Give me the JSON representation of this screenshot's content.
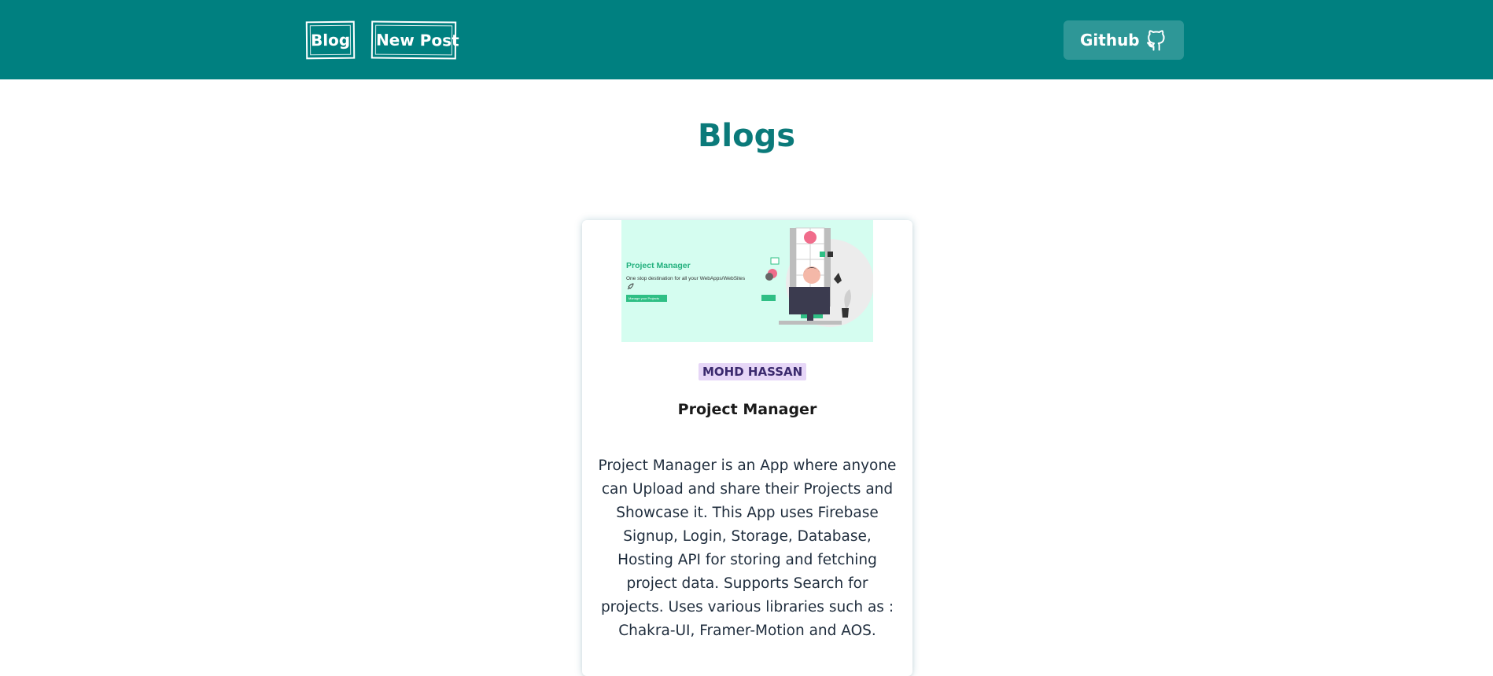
{
  "navbar": {
    "links": [
      {
        "label": "Blog"
      },
      {
        "label": "New Post"
      }
    ],
    "github": {
      "label": "Github",
      "icon": "github-icon"
    }
  },
  "page": {
    "title": "Blogs"
  },
  "post": {
    "thumbnail": {
      "title": "Project Manager",
      "subtitle": "One stop destination for all your WebApps/WebSites",
      "button": "Manage your Projects"
    },
    "author": "MOHD HASSAN",
    "title": "Project Manager",
    "description": "Project Manager is an App where anyone can Upload and share their Projects and Showcase it. This App uses Firebase Signup, Login, Storage, Database, Hosting API for storing and fetching project data. Supports Search for projects. Uses various libraries such as : Chakra-UI, Framer-Motion and AOS."
  },
  "colors": {
    "navbar": "#008080",
    "title": "#0b7a7a",
    "badge_bg": "#e6d6f7",
    "thumbnail_bg": "#d5fdf0"
  }
}
